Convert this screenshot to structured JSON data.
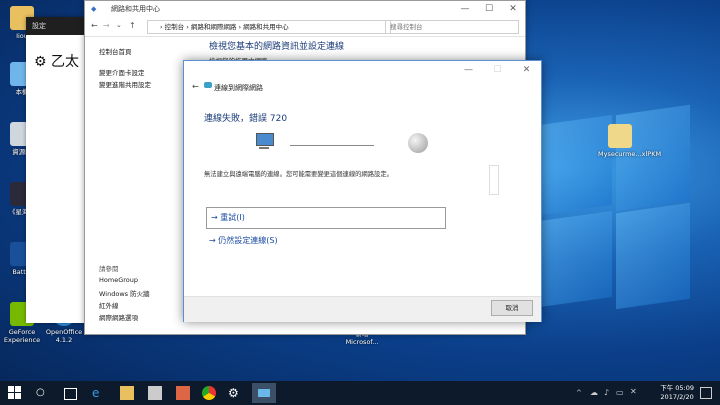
{
  "desktop": {
    "icons": [
      {
        "label": "Iiou",
        "name": "folder-icon"
      },
      {
        "label": "本機",
        "name": "this-pc-icon"
      },
      {
        "label": "資源回",
        "name": "recycle-bin-icon"
      },
      {
        "label": "《星海爆",
        "name": "game-icon"
      },
      {
        "label": "Battle",
        "name": "battlenet-icon"
      },
      {
        "label": "GeForce Experience",
        "name": "geforce-experience-icon"
      },
      {
        "label": "OpenOffice 4.1.2",
        "name": "openoffice-icon"
      },
      {
        "label": "新增 Microsof...",
        "name": "new-microsoft-doc-icon"
      },
      {
        "label": "Mysecurme...xlPKM",
        "name": "file-icon"
      }
    ]
  },
  "settings_window": {
    "title": "設定",
    "header": "乙太"
  },
  "network_window": {
    "title": "網路和共用中心",
    "breadcrumb": "› 控制台 › 網路和網際網路 › 網路和共用中心",
    "search_placeholder": "搜尋控制台",
    "left_nav": [
      "控制台首頁",
      "變更介面卡設定",
      "變更進階共用設定"
    ],
    "see_also_title": "請參閱",
    "see_also": [
      "HomeGroup",
      "Windows 防火牆",
      "紅外線",
      "網際網路選項"
    ],
    "main_title": "檢視您基本的網路資訊並設定連線",
    "sub_line": "檢視您的作用中網路"
  },
  "dialog": {
    "title": "連線到網際網路",
    "error_heading": "連線失敗，錯誤 720",
    "message": "無法建立與遠端電腦的連線。您可能需要變更這個連線的網路設定。",
    "retry_label": "重試(I)",
    "continue_label": "仍然設定連線(S)",
    "cancel_label": "取消"
  },
  "taskbar": {
    "time": "下午 05:09",
    "date": "2017/2/20"
  },
  "colors": {
    "accent": "#1a4aa0",
    "title_blue": "#1e3f7a",
    "taskbar": "#0d1a2b"
  }
}
